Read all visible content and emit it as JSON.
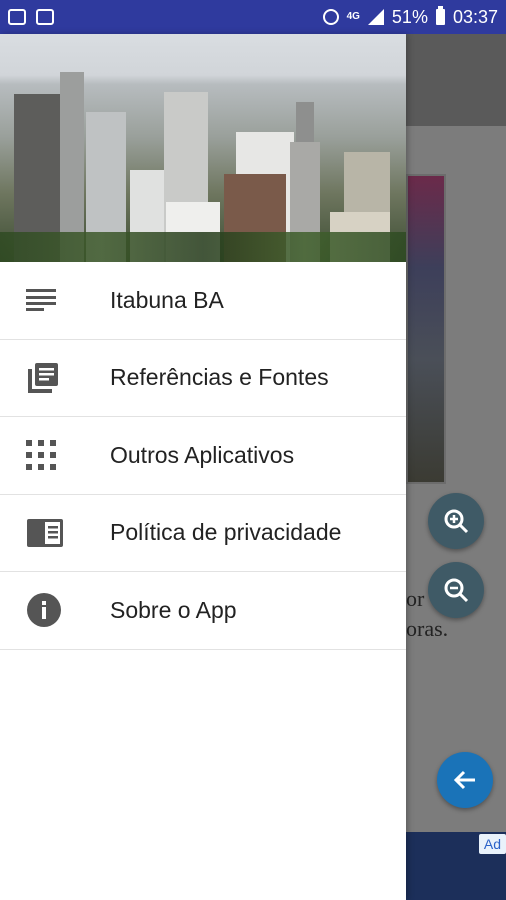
{
  "status_bar": {
    "network": "4G",
    "battery": "51%",
    "time": "03:37"
  },
  "drawer": {
    "menu": [
      {
        "label": "Itabuna BA",
        "icon": "list-lines-icon"
      },
      {
        "label": "Referências e Fontes",
        "icon": "library-books-icon"
      },
      {
        "label": "Outros Aplicativos",
        "icon": "apps-grid-icon"
      },
      {
        "label": "Política de privacidade",
        "icon": "reader-book-icon"
      },
      {
        "label": "Sobre o App",
        "icon": "info-icon"
      }
    ]
  },
  "background": {
    "text_line1": "or",
    "text_line2": "oras.",
    "ad_label": "Ad"
  },
  "colors": {
    "status_bar": "#2f3a9e",
    "icon": "#555555",
    "fab_zoom": "#3f5a66",
    "fab_back": "#1a73b8"
  }
}
